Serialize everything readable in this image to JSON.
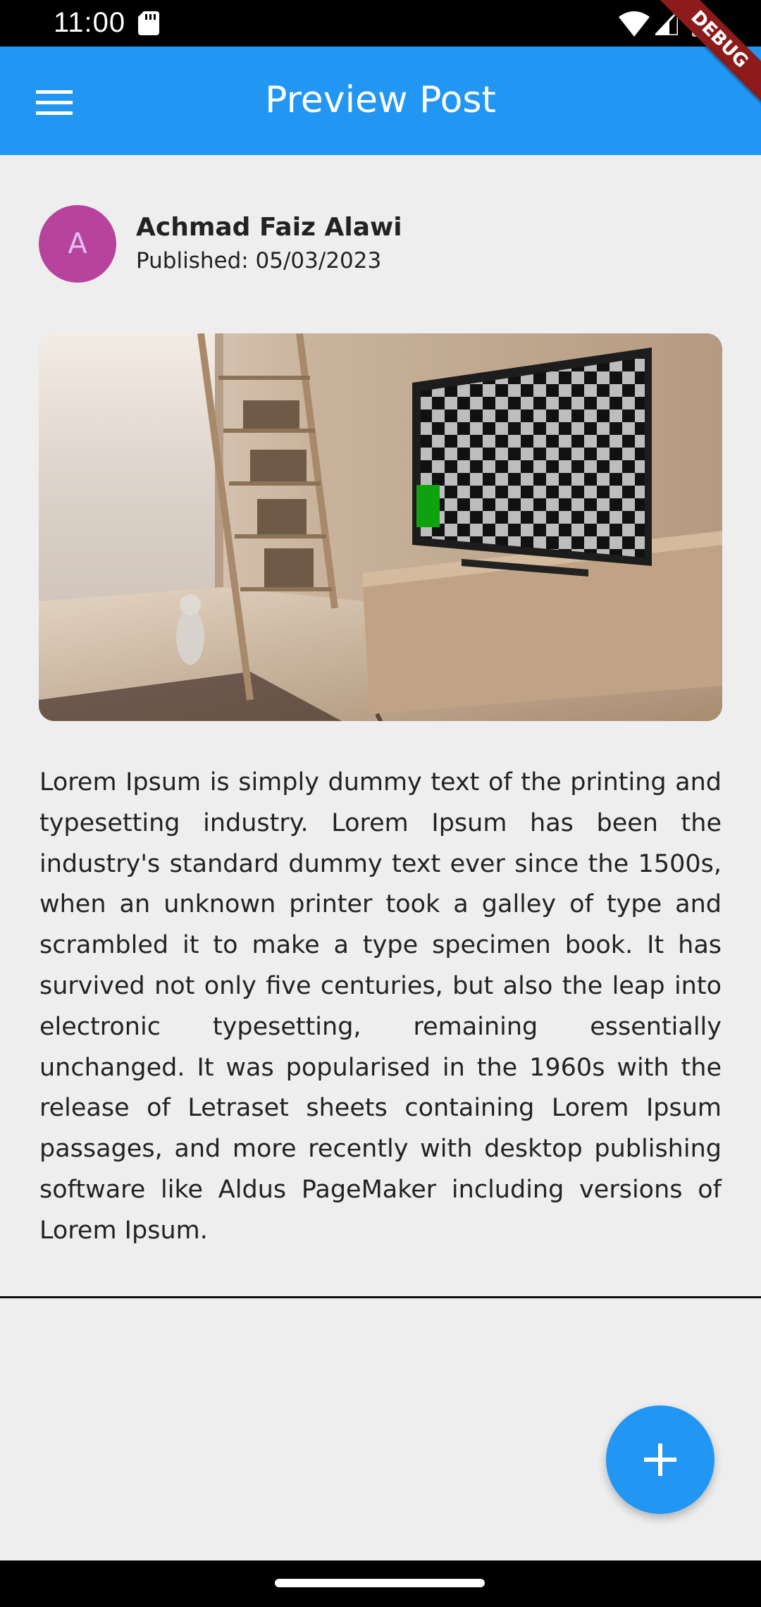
{
  "status_bar": {
    "time": "11:00",
    "icons": [
      "sd-card-icon",
      "wifi-icon",
      "signal-icon",
      "battery-icon"
    ]
  },
  "app_bar": {
    "title": "Preview Post",
    "background": "#2196f3",
    "menu_icon": "menu-icon"
  },
  "debug_banner": "DEBUG",
  "post": {
    "author_initial": "A",
    "author_name": "Achmad Faiz Alawi",
    "published": "Published: 05/03/2023",
    "avatar_color": "#b8439d",
    "image_description_icon": "living-room-tv-photo",
    "body": "Lorem Ipsum is simply dummy text of the printing and typesetting industry. Lorem Ipsum has been the industry's standard dummy text ever since the 1500s, when an unknown printer took a galley of type and scrambled it to make a type specimen book. It has survived not only five centuries, but also the leap into electronic typesetting, remaining essentially unchanged. It was popularised in the 1960s with the release of Letraset sheets containing Lorem Ipsum passages, and more recently with desktop publishing software like Aldus PageMaker including versions of Lorem Ipsum."
  },
  "fab": {
    "icon": "add-icon",
    "color": "#2196f3"
  }
}
